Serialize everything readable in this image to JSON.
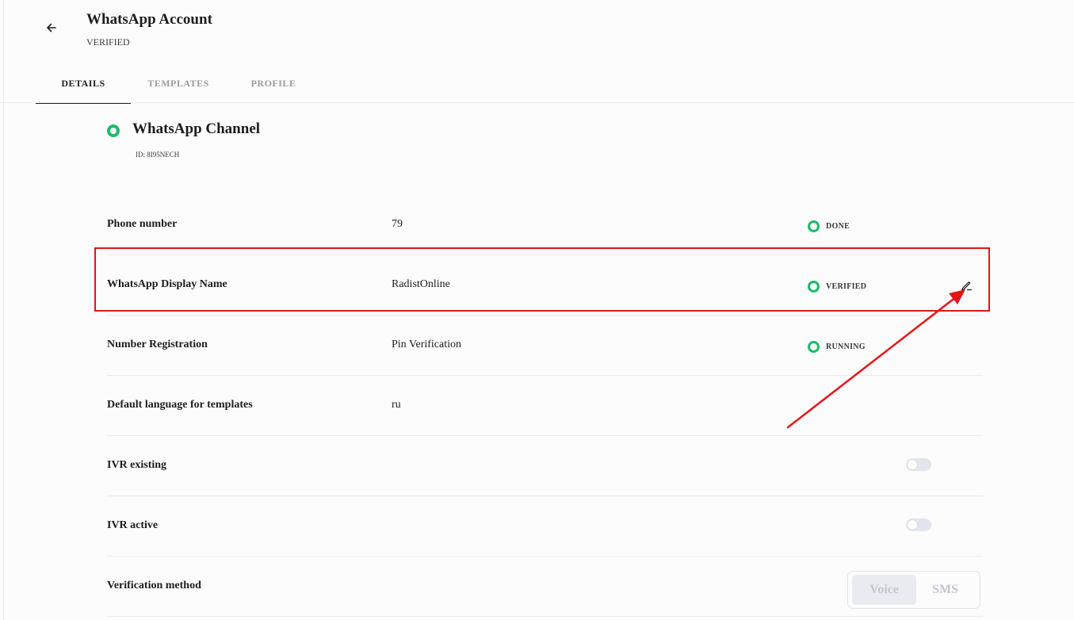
{
  "header": {
    "title": "WhatsApp Account",
    "status": "VERIFIED"
  },
  "tabs": [
    {
      "label": "DETAILS",
      "active": true
    },
    {
      "label": "TEMPLATES",
      "active": false
    },
    {
      "label": "PROFILE",
      "active": false
    }
  ],
  "channel": {
    "title": "WhatsApp Channel",
    "id": "ID: 8I95NECH"
  },
  "rows": {
    "phone": {
      "label": "Phone number",
      "value": "79",
      "status": "DONE"
    },
    "display_name": {
      "label": "WhatsApp Display Name",
      "value": "RadistOnline",
      "status": "VERIFIED"
    },
    "registration": {
      "label": "Number Registration",
      "value": "Pin Verification",
      "status": "RUNNING"
    },
    "language": {
      "label": "Default language for templates",
      "value": "ru"
    },
    "ivr_existing": {
      "label": "IVR existing",
      "enabled": false
    },
    "ivr_active": {
      "label": "IVR active",
      "enabled": false
    },
    "verification": {
      "label": "Verification method",
      "options": [
        "Voice",
        "SMS"
      ],
      "selected": "Voice"
    }
  },
  "colors": {
    "status_green": "#1dbb6a",
    "annotation_red": "#e61515"
  },
  "icons": {
    "back": "arrow-left-icon",
    "edit": "pencil-icon"
  }
}
